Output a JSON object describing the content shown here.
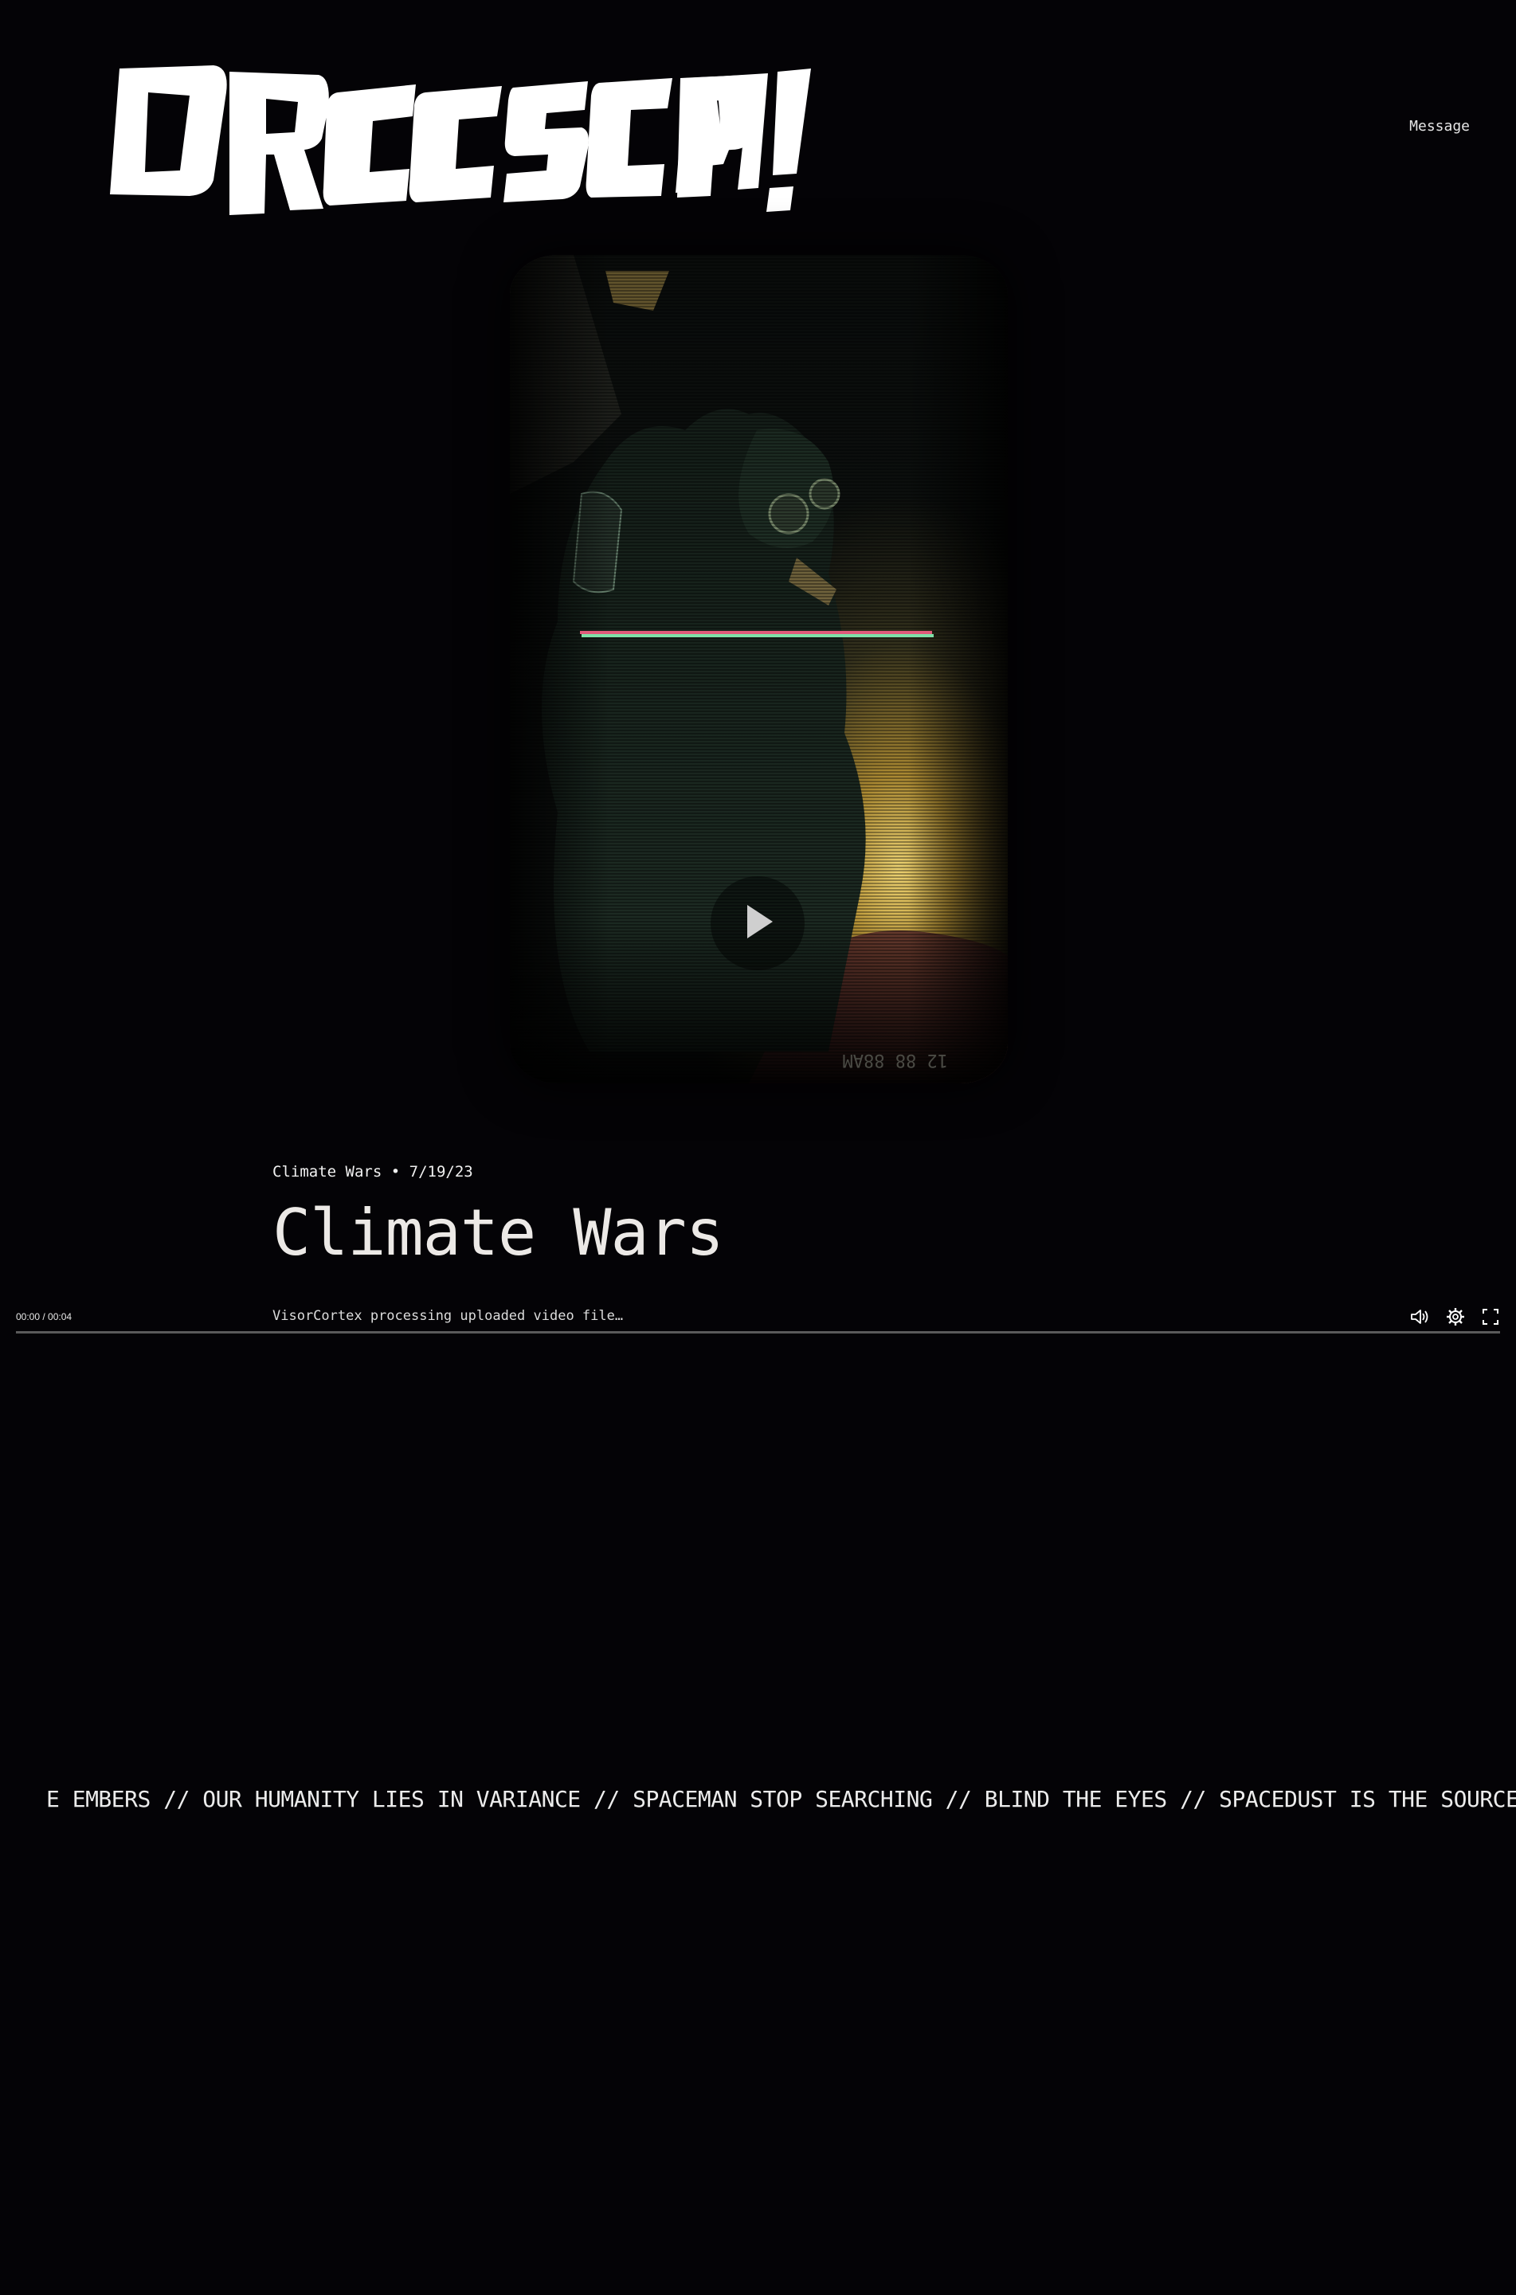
{
  "header": {
    "logo_text": "DRCCSCIPM!",
    "message_link": "Message"
  },
  "player": {
    "timecode": "00:00 / 00:04",
    "progress": 0,
    "overlay_stamp": "12 88 88AM",
    "icons": {
      "play": "play-icon",
      "volume": "volume-icon",
      "settings": "gear-icon",
      "fullscreen": "fullscreen-icon"
    }
  },
  "post": {
    "meta_category": "Climate Wars",
    "meta_separator": "•",
    "meta_date": "7/19/23",
    "title": "Climate Wars",
    "description": "VisorCortex processing uploaded video file…"
  },
  "ticker": {
    "text": "E EMBERS // OUR HUMANITY LIES IN VARIANCE // SPACEMAN STOP SEARCHING // BLIND THE EYES // SPACEDUST IS THE SOURCE OF"
  },
  "colors": {
    "background": "#040306",
    "text": "#e8e6e3",
    "progress_track": "#5a5a5a"
  }
}
